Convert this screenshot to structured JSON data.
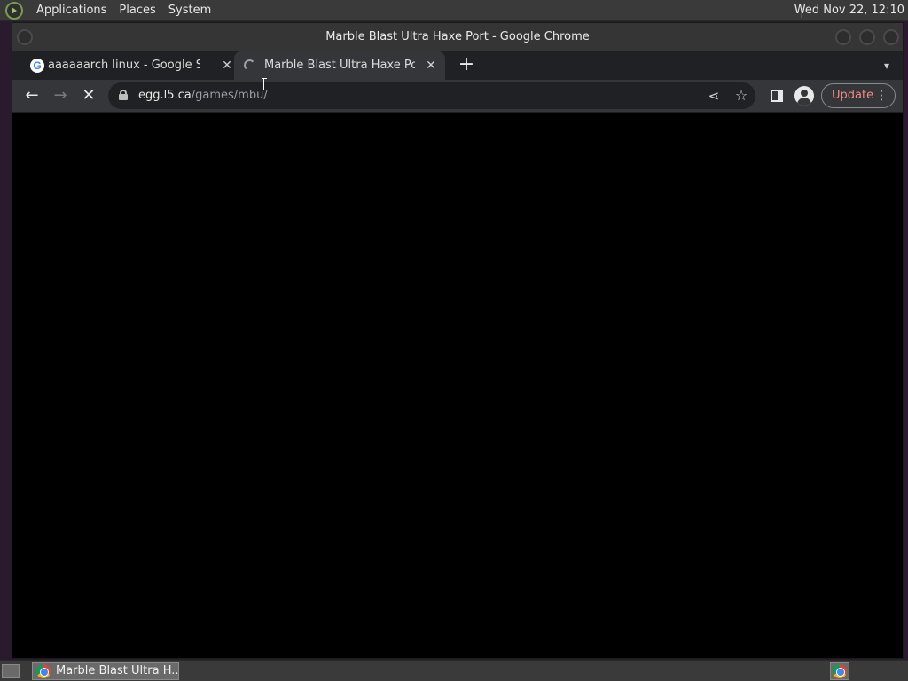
{
  "top_panel": {
    "menus": [
      "Applications",
      "Places",
      "System"
    ],
    "clock": "Wed Nov 22, 12:10"
  },
  "window": {
    "title": "Marble Blast Ultra Haxe Port - Google Chrome"
  },
  "tabs": [
    {
      "label": "aaaaaarch linux - Google Sear",
      "favicon": "google-icon",
      "active": false
    },
    {
      "label": "Marble Blast Ultra Haxe Port",
      "favicon": "loading-spinner-icon",
      "active": true
    }
  ],
  "toolbar": {
    "url_host": "egg.l5.ca",
    "url_path": "/games/mbu/",
    "update_label": "Update"
  },
  "page": {
    "background": "#000000",
    "loading": true
  },
  "taskbar": {
    "items": [
      {
        "label": "Marble Blast Ultra H..."
      }
    ]
  },
  "colors": {
    "update_text": "#f28b82",
    "panel_bg": "#3a3a3a",
    "tab_active_bg": "#35363a",
    "tabstrip_bg": "#202124"
  }
}
